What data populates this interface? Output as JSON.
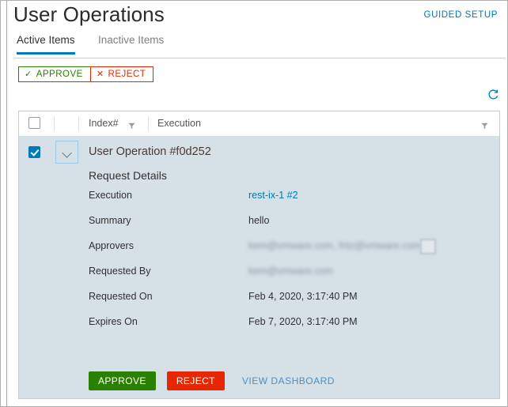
{
  "header": {
    "title": "User Operations",
    "guided_setup_label": "GUIDED SETUP"
  },
  "tabs": [
    {
      "label": "Active Items",
      "active": true
    },
    {
      "label": "Inactive Items",
      "active": false
    }
  ],
  "toolbar": {
    "approve_label": "APPROVE",
    "approve_glyph": "✓",
    "reject_label": "REJECT",
    "reject_glyph": "✕",
    "refresh_icon": "refresh-icon"
  },
  "table": {
    "columns": [
      {
        "label": "Index#",
        "filter_icon": "filter-icon"
      },
      {
        "label": "Execution",
        "filter_icon": "filter-icon"
      }
    ],
    "select_all_checked": false
  },
  "row": {
    "checked": true,
    "expanded": true,
    "caret_icon": "chevron-down-icon",
    "title": "User Operation #f0d252",
    "details_title": "Request Details",
    "fields": [
      {
        "label": "Execution",
        "value": "rest-ix-1 #2",
        "kind": "link"
      },
      {
        "label": "Summary",
        "value": "hello",
        "kind": "text"
      },
      {
        "label": "Approvers",
        "value": "kem@vmware.com, fritz@vmware.com",
        "kind": "blurred"
      },
      {
        "label": "Requested By",
        "value": "kem@vmware.com",
        "kind": "blurred"
      },
      {
        "label": "Requested On",
        "value": "Feb 4, 2020, 3:17:40 PM",
        "kind": "text"
      },
      {
        "label": "Expires On",
        "value": "Feb 7, 2020, 3:17:40 PM",
        "kind": "text"
      }
    ],
    "actions": {
      "approve_label": "APPROVE",
      "reject_label": "REJECT",
      "view_dashboard_label": "VIEW DASHBOARD"
    }
  },
  "colors": {
    "accent_blue": "#0079b8",
    "approve_green": "#2a8001",
    "reject_red": "#e62700",
    "row_selected_bg": "#d5e0e7",
    "link_blue": "#4d8fc0"
  }
}
